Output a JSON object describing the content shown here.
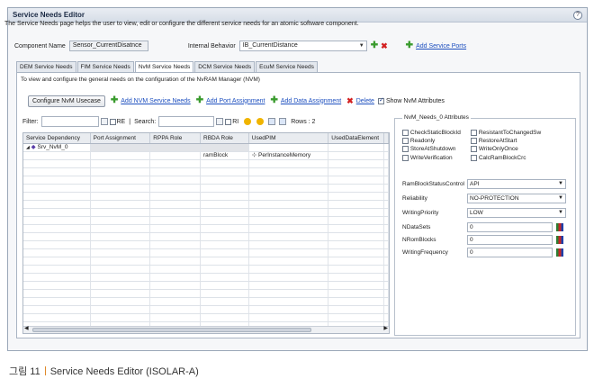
{
  "window": {
    "title": "Service Needs Editor",
    "help_glyph": "?"
  },
  "description": "The Service Needs page helps the user to view, edit or configure the different service needs for an atomic software component.",
  "component": {
    "label": "Component Name",
    "value": "Sensor_CurrentDisatnce"
  },
  "behavior": {
    "label": "Internal Behavior",
    "value": "IB_CurrentDistance"
  },
  "add_ports_link": "Add Service Ports",
  "tabs": [
    {
      "label": "DEM Service Needs"
    },
    {
      "label": "FIM Service Needs"
    },
    {
      "label": "NvM Service Needs"
    },
    {
      "label": "DCM Service Needs"
    },
    {
      "label": "EcuM Service Needs"
    }
  ],
  "panel_description": "To view and configure the general needs on the configuration of the NvRAM Manager (NVM)",
  "toolbar": {
    "configure": "Configure NvM Usecase",
    "add_nvm": "Add NVM Service Needs",
    "add_port": "Add Port Assignment",
    "add_data": "Add Data Assignment",
    "delete": "Delete",
    "show_attrs": "Show NvM Attributes"
  },
  "filter": {
    "label": "Filter:",
    "re": "RE",
    "search": "Search:",
    "ri": "RI",
    "rows": "Rows : 2"
  },
  "grid": {
    "headers": [
      "Service Dependency",
      "Port Assignment",
      "RPPA Role",
      "RBDA Role",
      "UsedPIM",
      "UsedDataElement"
    ],
    "rows": [
      {
        "dep": "Srv_NvM_0",
        "rbda": "",
        "pim": ""
      },
      {
        "dep": "",
        "rbda": "ramBlock",
        "pim": "PerInstanceMemory"
      }
    ]
  },
  "attributes": {
    "title": "NvM_Needs_0 Attributes",
    "checkboxes": [
      "CheckStaticBlockId",
      "ResistantToChangedSw",
      "Readonly",
      "RestoreAtStart",
      "StoreAtShutdown",
      "WriteOnlyOnce",
      "WriteVerification",
      "CalcRamBlockCrc"
    ],
    "fields": [
      {
        "label": "RamBlockStatusControl",
        "value": "API"
      },
      {
        "label": "Reliability",
        "value": "NO-PROTECTION"
      },
      {
        "label": "WritingPriority",
        "value": "LOW"
      },
      {
        "label": "NDataSets",
        "value": "0"
      },
      {
        "label": "NRomBlocks",
        "value": "0"
      },
      {
        "label": "WritingFrequency",
        "value": "0"
      }
    ]
  },
  "caption": {
    "prefix": "그림 11",
    "text": "Service Needs Editor (ISOLAR-A)"
  }
}
